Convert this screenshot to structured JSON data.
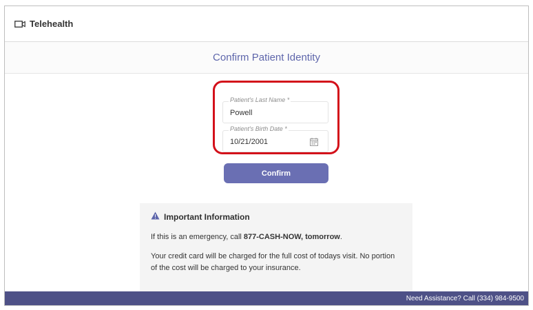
{
  "header": {
    "brand_label": "Telehealth",
    "brand_icon": "video-camera-icon"
  },
  "page": {
    "title": "Confirm Patient Identity"
  },
  "form": {
    "last_name": {
      "label": "Patient's Last Name *",
      "value": "Powell"
    },
    "birth_date": {
      "label": "Patient's Birth Date *",
      "value": "10/21/2001",
      "icon": "calendar-icon"
    },
    "confirm_label": "Confirm"
  },
  "info": {
    "icon": "warning-icon",
    "title": "Important Information",
    "emergency_prefix": "If this is an emergency, call ",
    "emergency_number": "877-CASH-NOW, tomorrow",
    "emergency_suffix": ".",
    "charge_notice": "Your credit card will be charged for the full cost of todays visit. No portion of the cost will be charged to your insurance."
  },
  "footer": {
    "assistance_text": "Need Assistance? Call (334) 984-9500"
  },
  "colors": {
    "accent": "#6a6fb3",
    "title_text": "#5e66ab",
    "footer_bg": "#4e5187",
    "highlight": "#d3101a"
  }
}
